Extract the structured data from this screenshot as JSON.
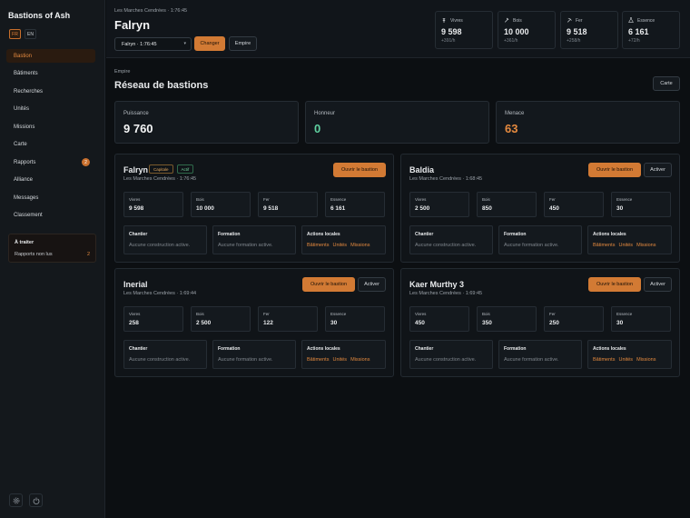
{
  "app_title": "Bastions of Ash",
  "languages": [
    "FR",
    "EN"
  ],
  "nav": [
    {
      "label": "Bastion",
      "active": true
    },
    {
      "label": "Bâtiments"
    },
    {
      "label": "Recherches"
    },
    {
      "label": "Unités"
    },
    {
      "label": "Missions"
    },
    {
      "label": "Carte"
    },
    {
      "label": "Rapports",
      "badge": "2"
    },
    {
      "label": "Alliance"
    },
    {
      "label": "Messages"
    },
    {
      "label": "Classement"
    }
  ],
  "todo": {
    "title": "À traiter",
    "label": "Rapports non lus",
    "count": "2"
  },
  "footer_icons": [
    "settings-icon",
    "power-icon"
  ],
  "header": {
    "breadcrumb": "Les Marches Cendrées · 1:76:45",
    "title": "Falryn",
    "select_value": "Falryn · 1:76:45",
    "change_label": "Changer",
    "empire_label": "Empire"
  },
  "resources": [
    {
      "icon": "wheat-icon",
      "label": "Vivres",
      "value": "9 598",
      "rate": "+391/h"
    },
    {
      "icon": "axe-icon",
      "label": "Bois",
      "value": "10 000",
      "rate": "+361/h"
    },
    {
      "icon": "pickaxe-icon",
      "label": "Fer",
      "value": "9 518",
      "rate": "+258/h"
    },
    {
      "icon": "flask-icon",
      "label": "Essence",
      "value": "6 161",
      "rate": "+72/h"
    }
  ],
  "empire": {
    "section_label": "Empire",
    "title": "Réseau de bastions",
    "map_button": "Carte",
    "stats": [
      {
        "label": "Puissance",
        "value": "9 760",
        "color": "#f4f5f6"
      },
      {
        "label": "Honneur",
        "value": "0",
        "color": "#5fd0a0"
      },
      {
        "label": "Menace",
        "value": "63",
        "color": "#e58a3f"
      }
    ]
  },
  "bastions": [
    {
      "name": "Falryn",
      "tags": [
        {
          "label": "Capitale",
          "kind": "cap"
        },
        {
          "label": "Actif",
          "kind": "act"
        }
      ],
      "location": "Les Marches Cendrées · 1:76:45",
      "open_label": "Ouvrir le bastion",
      "resources": [
        {
          "label": "Vivres",
          "value": "9 598"
        },
        {
          "label": "Bois",
          "value": "10 000"
        },
        {
          "label": "Fer",
          "value": "9 518"
        },
        {
          "label": "Essence",
          "value": "6 161"
        }
      ],
      "worksite": {
        "label": "Chantier",
        "text": "Aucune construction active."
      },
      "training": {
        "label": "Formation",
        "text": "Aucune formation active."
      },
      "actions": {
        "label": "Actions locales",
        "links": [
          "Bâtiments",
          "Unités",
          "Missions"
        ]
      }
    },
    {
      "name": "Baldia",
      "tags": [],
      "location": "Les Marches Cendrées · 1:68:45",
      "open_label": "Ouvrir le bastion",
      "activate_label": "Activer",
      "resources": [
        {
          "label": "Vivres",
          "value": "2 500"
        },
        {
          "label": "Bois",
          "value": "850"
        },
        {
          "label": "Fer",
          "value": "450"
        },
        {
          "label": "Essence",
          "value": "30"
        }
      ],
      "worksite": {
        "label": "Chantier",
        "text": "Aucune construction active."
      },
      "training": {
        "label": "Formation",
        "text": "Aucune formation active."
      },
      "actions": {
        "label": "Actions locales",
        "links": [
          "Bâtiments",
          "Unités",
          "Missions"
        ]
      }
    },
    {
      "name": "Inerial",
      "tags": [],
      "location": "Les Marches Cendrées · 1:69:44",
      "open_label": "Ouvrir le bastion",
      "activate_label": "Activer",
      "resources": [
        {
          "label": "Vivres",
          "value": "258"
        },
        {
          "label": "Bois",
          "value": "2 500"
        },
        {
          "label": "Fer",
          "value": "122"
        },
        {
          "label": "Essence",
          "value": "30"
        }
      ],
      "worksite": {
        "label": "Chantier",
        "text": "Aucune construction active."
      },
      "training": {
        "label": "Formation",
        "text": "Aucune formation active."
      },
      "actions": {
        "label": "Actions locales",
        "links": [
          "Bâtiments",
          "Unités",
          "Missions"
        ]
      }
    },
    {
      "name": "Kaer Murthy 3",
      "tags": [],
      "location": "Les Marches Cendrées · 1:69:45",
      "open_label": "Ouvrir le bastion",
      "activate_label": "Activer",
      "resources": [
        {
          "label": "Vivres",
          "value": "450"
        },
        {
          "label": "Bois",
          "value": "350"
        },
        {
          "label": "Fer",
          "value": "250"
        },
        {
          "label": "Essence",
          "value": "30"
        }
      ],
      "worksite": {
        "label": "Chantier",
        "text": "Aucune construction active."
      },
      "training": {
        "label": "Formation",
        "text": "Aucune formation active."
      },
      "actions": {
        "label": "Actions locales",
        "links": [
          "Bâtiments",
          "Unités",
          "Missions"
        ]
      }
    }
  ]
}
